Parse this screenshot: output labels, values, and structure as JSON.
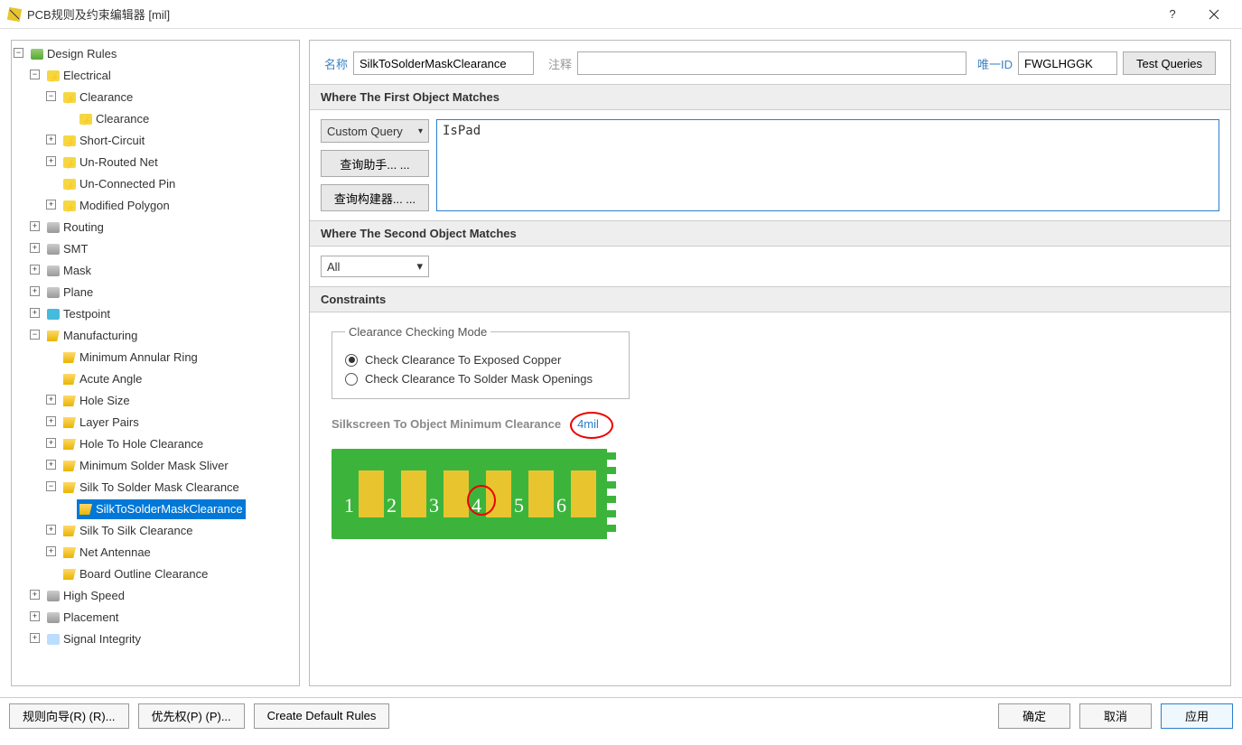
{
  "titlebar": {
    "title": "PCB规则及约束编辑器 [mil]"
  },
  "tree": {
    "root": "Design Rules",
    "electrical": "Electrical",
    "clearance": "Clearance",
    "clearance_rule": "Clearance",
    "short_circuit": "Short-Circuit",
    "unrouted": "Un-Routed Net",
    "unconnected": "Un-Connected Pin",
    "modpoly": "Modified Polygon",
    "routing": "Routing",
    "smt": "SMT",
    "mask": "Mask",
    "plane": "Plane",
    "testpoint": "Testpoint",
    "manufacturing": "Manufacturing",
    "min_annular": "Minimum Annular Ring",
    "acute": "Acute Angle",
    "hole_size": "Hole Size",
    "layer_pairs": "Layer Pairs",
    "hole_to_hole": "Hole To Hole Clearance",
    "min_sm_sliver": "Minimum Solder Mask Sliver",
    "silk_to_sm": "Silk To Solder Mask Clearance",
    "silk_to_sm_rule": "SilkToSolderMaskClearance",
    "silk_to_silk": "Silk To Silk Clearance",
    "net_antennae": "Net Antennae",
    "board_outline": "Board Outline Clearance",
    "high_speed": "High Speed",
    "placement": "Placement",
    "sig_integrity": "Signal Integrity"
  },
  "detail": {
    "name_lbl": "名称",
    "name_val": "SilkToSolderMaskClearance",
    "comment_lbl": "注释",
    "comment_val": "",
    "uid_lbl": "唯一ID",
    "uid_val": "FWGLHGGK",
    "test_queries": "Test Queries",
    "where_first": "Where The First Object Matches",
    "custom_query": "Custom Query",
    "query_text": "IsPad",
    "query_helper": "查询助手... ...",
    "query_builder": "查询构建器... ...",
    "where_second": "Where The Second Object Matches",
    "second_match": "All",
    "constraints_hdr": "Constraints",
    "ccm_legend": "Clearance Checking Mode",
    "radio1": "Check Clearance To Exposed Copper",
    "radio2": "Check Clearance To Solder Mask Openings",
    "min_clear_lbl": "Silkscreen To Object Minimum Clearance",
    "min_clear_val": "4mil",
    "pad_numbers": [
      "1",
      "2",
      "3",
      "4",
      "5",
      "6"
    ]
  },
  "footer": {
    "rule_wizard": "规则向导(R) (R)...",
    "priority": "优先权(P) (P)...",
    "create_default": "Create Default Rules",
    "ok": "确定",
    "cancel": "取消",
    "apply": "应用"
  }
}
